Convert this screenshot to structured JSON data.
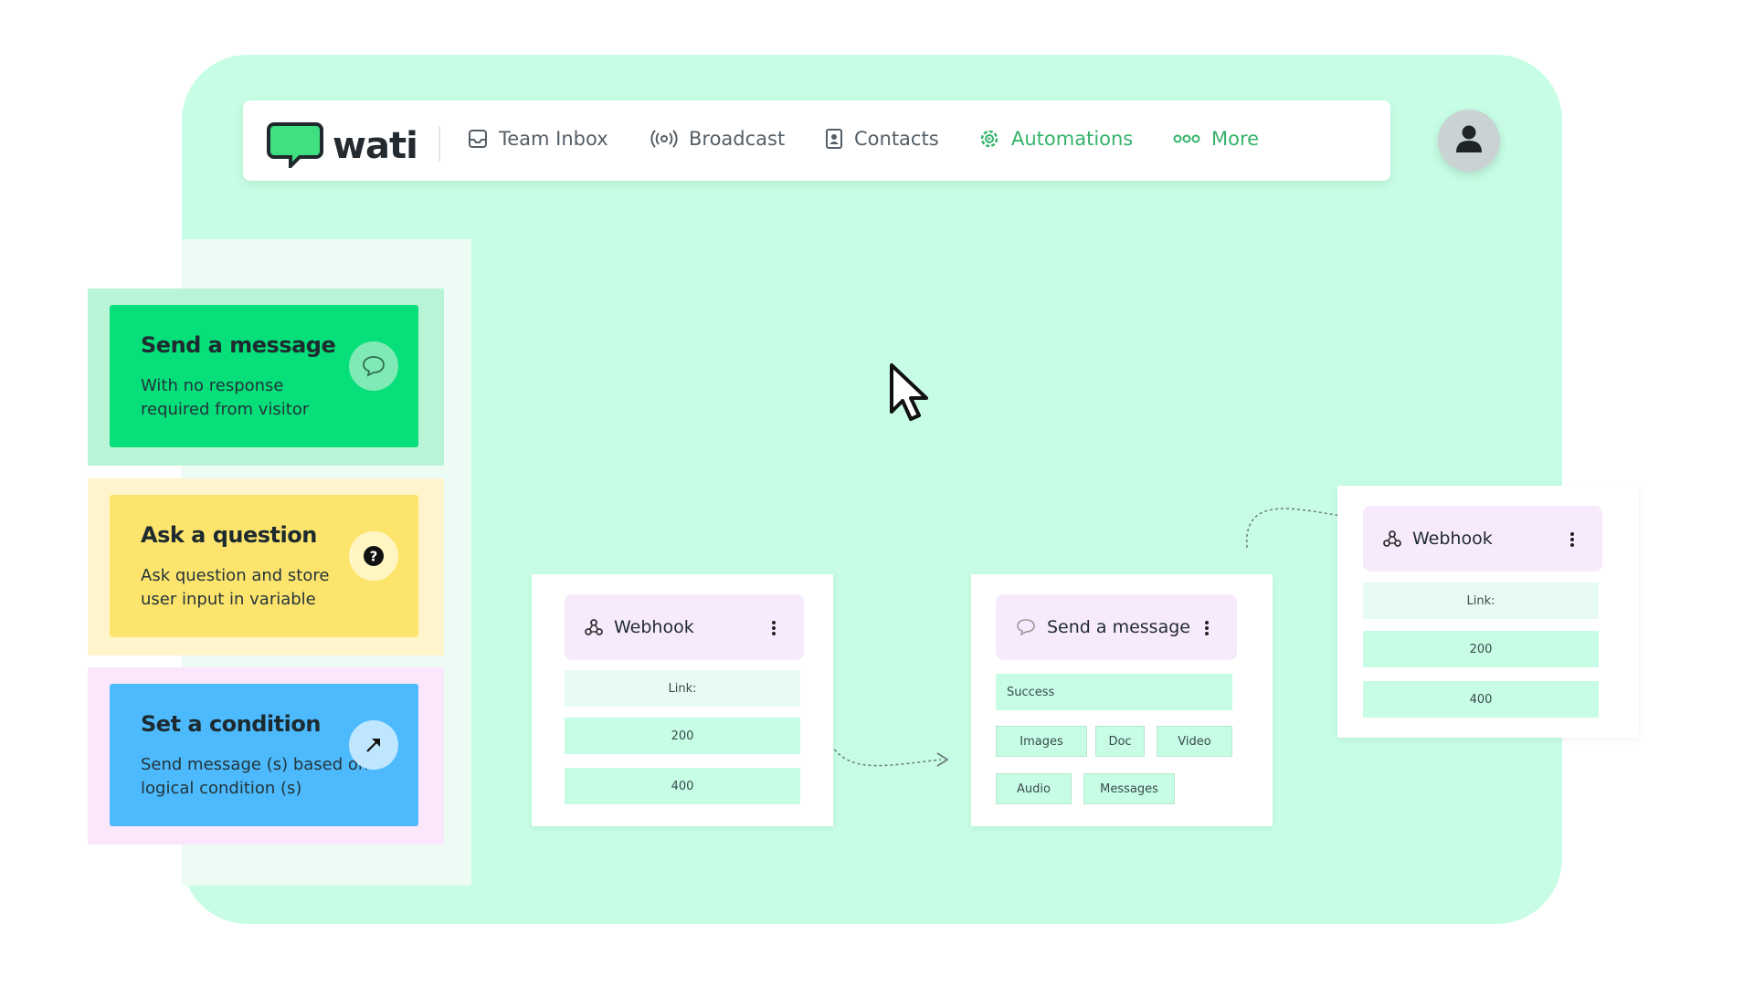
{
  "brand": {
    "name": "wati",
    "accent": "#35b36a"
  },
  "nav": {
    "items": [
      {
        "label": "Team Inbox",
        "icon": "inbox-icon"
      },
      {
        "label": "Broadcast",
        "icon": "broadcast-icon"
      },
      {
        "label": "Contacts",
        "icon": "contacts-icon"
      },
      {
        "label": "Automations",
        "icon": "automations-gear-icon",
        "active": true
      },
      {
        "label": "More",
        "icon": "more-dots-icon"
      }
    ]
  },
  "sidebar": {
    "tiles": [
      {
        "title": "Send a message",
        "desc": "With no response required from visitor",
        "color": "#06df7a",
        "icon": "chat-bubble-icon"
      },
      {
        "title": "Ask a question",
        "desc": "Ask question and store user input in variable",
        "color": "#fde56d",
        "icon": "question-icon"
      },
      {
        "title": "Set a condition",
        "desc": "Send message (s) based on logical condition (s)",
        "color": "#4cbafd",
        "icon": "condition-arrow-icon"
      }
    ]
  },
  "canvas": {
    "webhook_node_1": {
      "title": "Webhook",
      "fields": [
        "Link:",
        "200",
        "400"
      ]
    },
    "send_message_node": {
      "title": "Send a message",
      "success": "Success",
      "chips_row1": [
        "Images",
        "Doc",
        "Video"
      ],
      "chips_row2": [
        "Audio",
        "Messages"
      ]
    },
    "webhook_node_2": {
      "title": "Webhook",
      "fields": [
        "Link:",
        "200",
        "400"
      ]
    }
  }
}
